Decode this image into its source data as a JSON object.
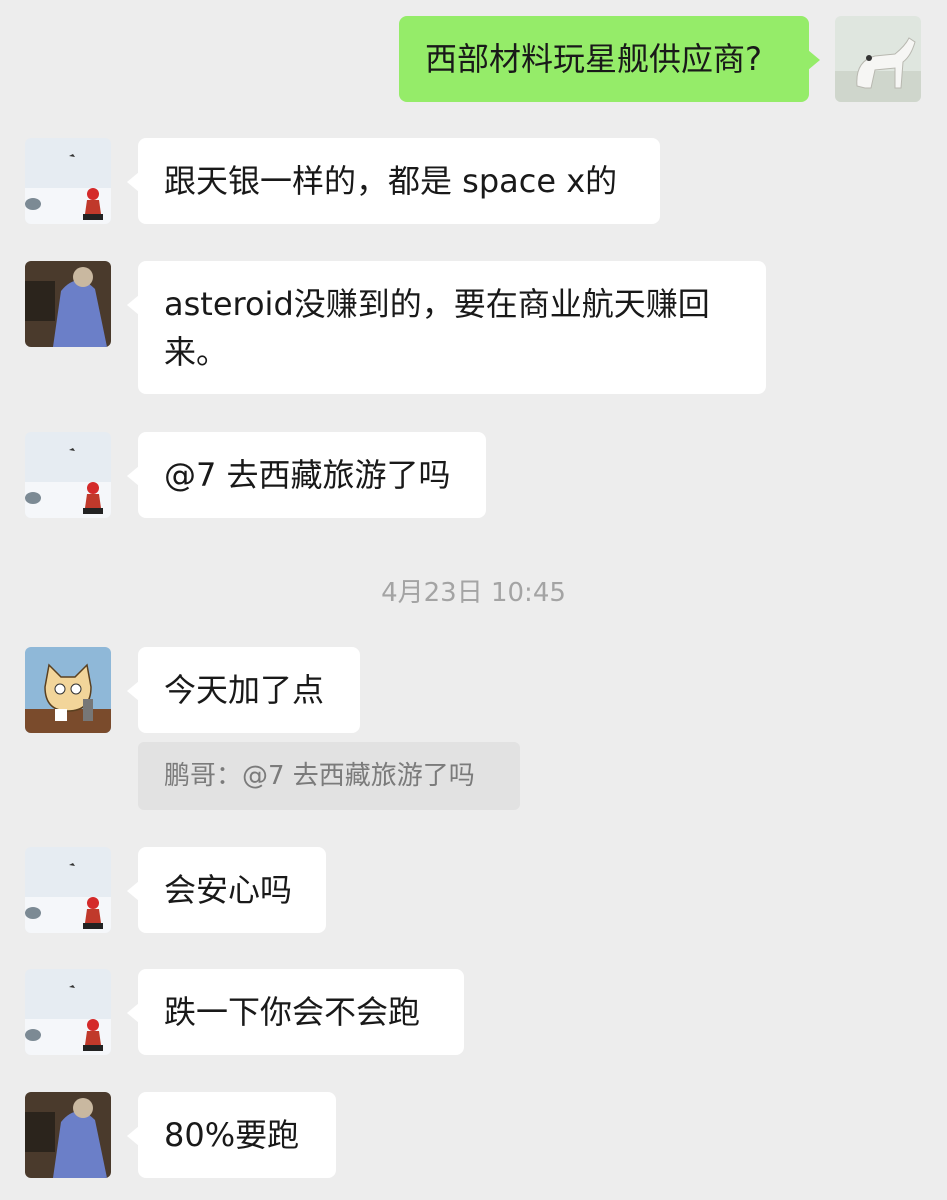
{
  "messages": [
    {
      "sender": "self",
      "avatar": "white-horse-avatar",
      "text": "西部材料玩星舰供应商?"
    },
    {
      "sender": "other",
      "avatar": "snow-scene-avatar",
      "text": "跟天银一样的，都是 space x的"
    },
    {
      "sender": "other",
      "avatar": "blue-sweater-avatar",
      "text": "asteroid没赚到的，要在商业航天赚回来。"
    },
    {
      "sender": "other",
      "avatar": "snow-scene-avatar",
      "text": "@7 去西藏旅游了吗"
    },
    {
      "sender": "other",
      "avatar": "cartoon-cat-avatar",
      "text": "今天加了点",
      "quote": "鹏哥：@7 去西藏旅游了吗"
    },
    {
      "sender": "other",
      "avatar": "snow-scene-avatar",
      "text": "会安心吗"
    },
    {
      "sender": "other",
      "avatar": "snow-scene-avatar",
      "text": "跌一下你会不会跑"
    },
    {
      "sender": "other",
      "avatar": "blue-sweater-avatar",
      "text": "80%要跑"
    }
  ],
  "timestamp": "4月23日 10:45",
  "colors": {
    "background": "#ededed",
    "self_bubble": "#95ec69",
    "other_bubble": "#ffffff",
    "quote_bg": "#e2e2e2"
  }
}
